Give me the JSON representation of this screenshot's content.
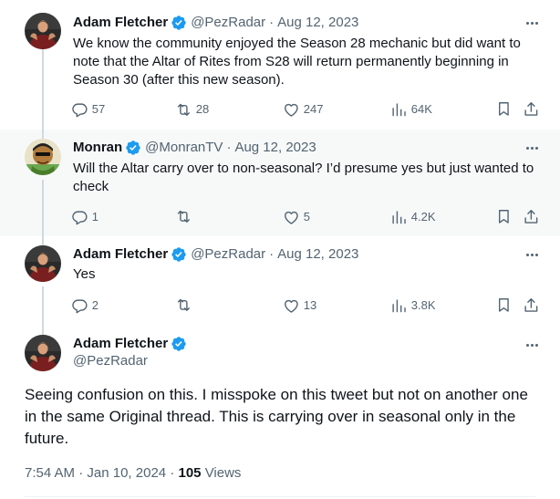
{
  "colors": {
    "text": "#0f1419",
    "muted": "#536471",
    "verified": "#1d9bf0",
    "thread_line": "#cfd9de",
    "highlight_bg": "#f7f9f9"
  },
  "tweets": [
    {
      "author": "Adam Fletcher",
      "handle": "@PezRadar",
      "separator": "·",
      "date": "Aug 12, 2023",
      "text": "We know the community enjoyed the Season 28 mechanic but did want to note that the Altar of Rites from S28 will return permanently beginning in Season 30 (after this new season).",
      "replies": "57",
      "reposts": "28",
      "likes": "247",
      "views": "64K"
    },
    {
      "author": "Monran",
      "handle": "@MonranTV",
      "separator": "·",
      "date": "Aug 12, 2023",
      "text": "Will the Altar carry over to non-seasonal? I’d presume yes but just wanted to check",
      "replies": "1",
      "reposts": "",
      "likes": "5",
      "views": "4.2K"
    },
    {
      "author": "Adam Fletcher",
      "handle": "@PezRadar",
      "separator": "·",
      "date": "Aug 12, 2023",
      "text": "Yes",
      "replies": "2",
      "reposts": "",
      "likes": "13",
      "views": "3.8K"
    }
  ],
  "main_tweet": {
    "author": "Adam Fletcher",
    "handle": "@PezRadar",
    "text": "Seeing confusion on this.  I misspoke on this tweet but not on another one in the same Original thread.  This is carrying over in seasonal only in the future.",
    "time": "7:54 AM",
    "separator": "·",
    "date": "Jan 10, 2024",
    "separator2": "·",
    "views_count": "105",
    "views_label": "Views"
  },
  "icons": {
    "reply": "reply-icon",
    "repost": "repost-icon",
    "like": "like-icon",
    "views": "views-icon",
    "bookmark": "bookmark-icon",
    "share": "share-icon",
    "more": "more-icon",
    "verified": "verified-badge-icon"
  }
}
